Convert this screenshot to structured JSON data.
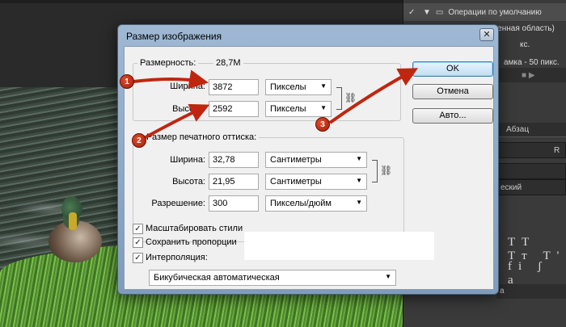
{
  "right_panel": {
    "actions": [
      {
        "label": "Операции по умолчанию",
        "checked": true,
        "expanded": true
      },
      {
        "label": "Виньетка (выделенная область)",
        "checked": true
      },
      {
        "label": "кс.",
        "checked": true
      },
      {
        "label": "амка - 50 пикс.",
        "checked": true
      },
      {
        "label": "",
        "checked": false
      }
    ],
    "tab_label": "Абзац",
    "char_row_1": "R",
    "char_row_2": "",
    "char_row_3": "еский",
    "text_styles_1": "TT Tт T'",
    "text_styles_2": "fi ʃ a",
    "bottom_label": "а"
  },
  "dialog": {
    "title": "Размер изображения",
    "close_label": "✕",
    "pixel_size_label": "Размерность:",
    "pixel_size_value": "28,7M",
    "width_label": "Ширина:",
    "width_value": "3872",
    "width_unit": "Пикселы",
    "height_label": "Высота:",
    "height_value": "2592",
    "height_unit": "Пикселы",
    "print_legend": "Размер печатного оттиска:",
    "print_width_label": "Ширина:",
    "print_width_value": "32,78",
    "print_width_unit": "Сантиметры",
    "print_height_label": "Высота:",
    "print_height_value": "21,95",
    "print_height_unit": "Сантиметры",
    "resolution_label": "Разрешение:",
    "resolution_value": "300",
    "resolution_unit": "Пикселы/дюйм",
    "ok_label": "OK",
    "cancel_label": "Отмена",
    "auto_label": "Авто...",
    "scale_styles_label": "Масштабировать стили",
    "constrain_label": "Сохранить пропорции",
    "resample_label": "Интерполяция:",
    "resample_method": "Бикубическая автоматическая",
    "scale_styles_checked": true,
    "constrain_checked": true,
    "resample_checked": true
  },
  "annotations": {
    "marker_1": "1",
    "marker_2": "2",
    "marker_3": "3",
    "arrow_color": "#c0260f"
  }
}
